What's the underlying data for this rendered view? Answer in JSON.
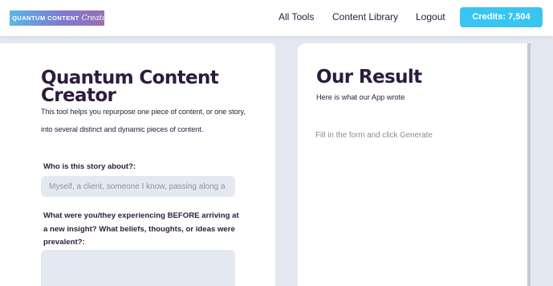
{
  "header": {
    "logo_main": "QUANTUM CONTENT",
    "logo_script": "Creator",
    "nav": {
      "all_tools": "All Tools",
      "content_library": "Content Library",
      "logout": "Logout"
    },
    "credits_label": "Credits: 7,504"
  },
  "form_panel": {
    "title": "Quantum Content Creator",
    "description": "This tool helps you repurpose one piece of content, or one story, into several distinct and dynamic pieces of content.",
    "field_1": {
      "label": "Who is this story about?:",
      "placeholder": "Myself, a client, someone I know, passing along a story"
    },
    "field_2": {
      "label": "What were you/they experiencing BEFORE arriving at a new insight? What beliefs, thoughts, or ideas were prevalent?:",
      "value": ""
    }
  },
  "result_panel": {
    "title": "Our Result",
    "subtitle": "Here is what our App wrote",
    "placeholder": "Fill in the form and click Generate"
  },
  "colors": {
    "accent": "#38c5f1",
    "text": "#2d1b3d",
    "background": "#e3e8f1"
  }
}
